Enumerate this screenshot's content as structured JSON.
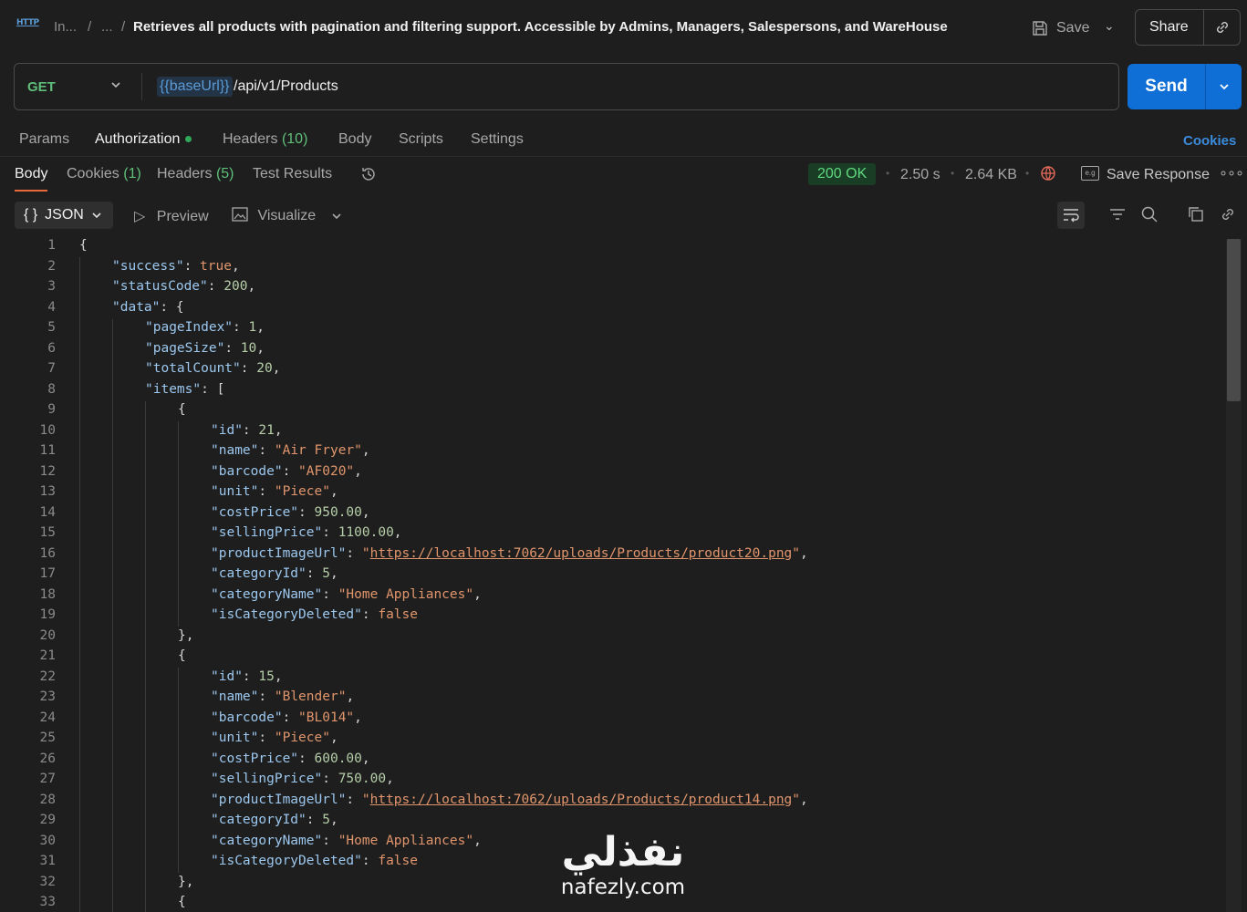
{
  "header": {
    "crumb1": "In...",
    "sep": "/",
    "crumb2": "...",
    "title": "Retrieves all products with pagination and filtering support. Accessible by Admins, Managers, Salespersons, and WareHouse",
    "save_label": "Save",
    "share_label": "Share"
  },
  "request": {
    "method": "GET",
    "url_variable": "{{baseUrl}}",
    "url_path": "/api/v1/Products",
    "send_label": "Send"
  },
  "request_tabs": {
    "params": "Params",
    "authorization": "Authorization",
    "headers": "Headers",
    "headers_count": "(10)",
    "body": "Body",
    "scripts": "Scripts",
    "settings": "Settings",
    "cookies": "Cookies"
  },
  "response_tabs": {
    "body": "Body",
    "cookies": "Cookies",
    "cookies_count": "(1)",
    "headers": "Headers",
    "headers_count": "(5)",
    "test_results": "Test Results"
  },
  "response_meta": {
    "status": "200 OK",
    "time": "2.50 s",
    "size": "2.64 KB",
    "save_response": "Save Response"
  },
  "viewer": {
    "format": "JSON",
    "preview": "Preview",
    "visualize": "Visualize"
  },
  "code_lines": [
    {
      "n": "1",
      "indent": 0,
      "parts": [
        [
          "p",
          "{"
        ]
      ]
    },
    {
      "n": "2",
      "indent": 1,
      "parts": [
        [
          "k",
          "\"success\""
        ],
        [
          "p",
          ": "
        ],
        [
          "b",
          "true"
        ],
        [
          "p",
          ","
        ]
      ]
    },
    {
      "n": "3",
      "indent": 1,
      "parts": [
        [
          "k",
          "\"statusCode\""
        ],
        [
          "p",
          ": "
        ],
        [
          "n",
          "200"
        ],
        [
          "p",
          ","
        ]
      ]
    },
    {
      "n": "4",
      "indent": 1,
      "parts": [
        [
          "k",
          "\"data\""
        ],
        [
          "p",
          ": {"
        ]
      ]
    },
    {
      "n": "5",
      "indent": 2,
      "parts": [
        [
          "k",
          "\"pageIndex\""
        ],
        [
          "p",
          ": "
        ],
        [
          "n",
          "1"
        ],
        [
          "p",
          ","
        ]
      ]
    },
    {
      "n": "6",
      "indent": 2,
      "parts": [
        [
          "k",
          "\"pageSize\""
        ],
        [
          "p",
          ": "
        ],
        [
          "n",
          "10"
        ],
        [
          "p",
          ","
        ]
      ]
    },
    {
      "n": "7",
      "indent": 2,
      "parts": [
        [
          "k",
          "\"totalCount\""
        ],
        [
          "p",
          ": "
        ],
        [
          "n",
          "20"
        ],
        [
          "p",
          ","
        ]
      ]
    },
    {
      "n": "8",
      "indent": 2,
      "parts": [
        [
          "k",
          "\"items\""
        ],
        [
          "p",
          ": ["
        ]
      ]
    },
    {
      "n": "9",
      "indent": 3,
      "parts": [
        [
          "p",
          "{"
        ]
      ]
    },
    {
      "n": "10",
      "indent": 4,
      "parts": [
        [
          "k",
          "\"id\""
        ],
        [
          "p",
          ": "
        ],
        [
          "n",
          "21"
        ],
        [
          "p",
          ","
        ]
      ]
    },
    {
      "n": "11",
      "indent": 4,
      "parts": [
        [
          "k",
          "\"name\""
        ],
        [
          "p",
          ": "
        ],
        [
          "s",
          "\"Air Fryer\""
        ],
        [
          "p",
          ","
        ]
      ]
    },
    {
      "n": "12",
      "indent": 4,
      "parts": [
        [
          "k",
          "\"barcode\""
        ],
        [
          "p",
          ": "
        ],
        [
          "s",
          "\"AF020\""
        ],
        [
          "p",
          ","
        ]
      ]
    },
    {
      "n": "13",
      "indent": 4,
      "parts": [
        [
          "k",
          "\"unit\""
        ],
        [
          "p",
          ": "
        ],
        [
          "s",
          "\"Piece\""
        ],
        [
          "p",
          ","
        ]
      ]
    },
    {
      "n": "14",
      "indent": 4,
      "parts": [
        [
          "k",
          "\"costPrice\""
        ],
        [
          "p",
          ": "
        ],
        [
          "n",
          "950.00"
        ],
        [
          "p",
          ","
        ]
      ]
    },
    {
      "n": "15",
      "indent": 4,
      "parts": [
        [
          "k",
          "\"sellingPrice\""
        ],
        [
          "p",
          ": "
        ],
        [
          "n",
          "1100.00"
        ],
        [
          "p",
          ","
        ]
      ]
    },
    {
      "n": "16",
      "indent": 4,
      "parts": [
        [
          "k",
          "\"productImageUrl\""
        ],
        [
          "p",
          ": "
        ],
        [
          "s",
          "\""
        ],
        [
          "u",
          "https://localhost:7062/uploads/Products/product20.png"
        ],
        [
          "s",
          "\""
        ],
        [
          "p",
          ","
        ]
      ]
    },
    {
      "n": "17",
      "indent": 4,
      "parts": [
        [
          "k",
          "\"categoryId\""
        ],
        [
          "p",
          ": "
        ],
        [
          "n",
          "5"
        ],
        [
          "p",
          ","
        ]
      ]
    },
    {
      "n": "18",
      "indent": 4,
      "parts": [
        [
          "k",
          "\"categoryName\""
        ],
        [
          "p",
          ": "
        ],
        [
          "s",
          "\"Home Appliances\""
        ],
        [
          "p",
          ","
        ]
      ]
    },
    {
      "n": "19",
      "indent": 4,
      "parts": [
        [
          "k",
          "\"isCategoryDeleted\""
        ],
        [
          "p",
          ": "
        ],
        [
          "b",
          "false"
        ]
      ]
    },
    {
      "n": "20",
      "indent": 3,
      "parts": [
        [
          "p",
          "},"
        ]
      ]
    },
    {
      "n": "21",
      "indent": 3,
      "parts": [
        [
          "p",
          "{"
        ]
      ]
    },
    {
      "n": "22",
      "indent": 4,
      "parts": [
        [
          "k",
          "\"id\""
        ],
        [
          "p",
          ": "
        ],
        [
          "n",
          "15"
        ],
        [
          "p",
          ","
        ]
      ]
    },
    {
      "n": "23",
      "indent": 4,
      "parts": [
        [
          "k",
          "\"name\""
        ],
        [
          "p",
          ": "
        ],
        [
          "s",
          "\"Blender\""
        ],
        [
          "p",
          ","
        ]
      ]
    },
    {
      "n": "24",
      "indent": 4,
      "parts": [
        [
          "k",
          "\"barcode\""
        ],
        [
          "p",
          ": "
        ],
        [
          "s",
          "\"BL014\""
        ],
        [
          "p",
          ","
        ]
      ]
    },
    {
      "n": "25",
      "indent": 4,
      "parts": [
        [
          "k",
          "\"unit\""
        ],
        [
          "p",
          ": "
        ],
        [
          "s",
          "\"Piece\""
        ],
        [
          "p",
          ","
        ]
      ]
    },
    {
      "n": "26",
      "indent": 4,
      "parts": [
        [
          "k",
          "\"costPrice\""
        ],
        [
          "p",
          ": "
        ],
        [
          "n",
          "600.00"
        ],
        [
          "p",
          ","
        ]
      ]
    },
    {
      "n": "27",
      "indent": 4,
      "parts": [
        [
          "k",
          "\"sellingPrice\""
        ],
        [
          "p",
          ": "
        ],
        [
          "n",
          "750.00"
        ],
        [
          "p",
          ","
        ]
      ]
    },
    {
      "n": "28",
      "indent": 4,
      "parts": [
        [
          "k",
          "\"productImageUrl\""
        ],
        [
          "p",
          ": "
        ],
        [
          "s",
          "\""
        ],
        [
          "u",
          "https://localhost:7062/uploads/Products/product14.png"
        ],
        [
          "s",
          "\""
        ],
        [
          "p",
          ","
        ]
      ]
    },
    {
      "n": "29",
      "indent": 4,
      "parts": [
        [
          "k",
          "\"categoryId\""
        ],
        [
          "p",
          ": "
        ],
        [
          "n",
          "5"
        ],
        [
          "p",
          ","
        ]
      ]
    },
    {
      "n": "30",
      "indent": 4,
      "parts": [
        [
          "k",
          "\"categoryName\""
        ],
        [
          "p",
          ": "
        ],
        [
          "s",
          "\"Home Appliances\""
        ],
        [
          "p",
          ","
        ]
      ]
    },
    {
      "n": "31",
      "indent": 4,
      "parts": [
        [
          "k",
          "\"isCategoryDeleted\""
        ],
        [
          "p",
          ": "
        ],
        [
          "b",
          "false"
        ]
      ]
    },
    {
      "n": "32",
      "indent": 3,
      "parts": [
        [
          "p",
          "},"
        ]
      ]
    },
    {
      "n": "33",
      "indent": 3,
      "parts": [
        [
          "p",
          "{"
        ]
      ]
    }
  ],
  "watermark": {
    "arabic": "نفذلي",
    "latin": "nafezly.com"
  },
  "icons": {
    "http": "http-request-icon",
    "save": "floppy-disk-icon",
    "link": "link-icon",
    "history": "history-icon",
    "globe": "globe-icon",
    "wrap": "word-wrap-icon",
    "filter": "filter-icon",
    "search": "search-icon",
    "copy": "copy-icon"
  },
  "colors": {
    "accent": "#0f6fd6",
    "status_ok": "#5fd87f",
    "method_get": "#5fbf7a",
    "active_tab_underline": "#e8693a"
  }
}
